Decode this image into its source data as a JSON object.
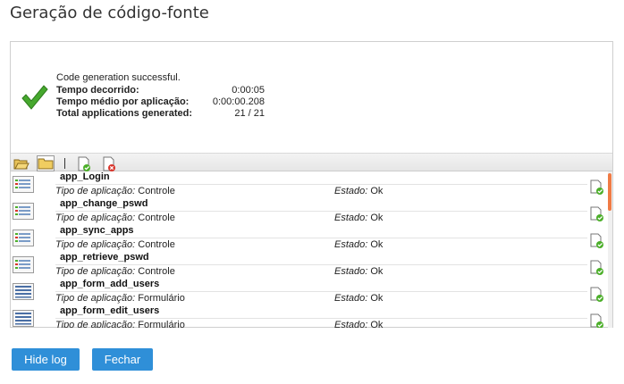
{
  "title": "Geração de código-fonte",
  "summary": {
    "message": "Code generation successful.",
    "rows": [
      {
        "label": "Tempo decorrido:",
        "value": "0:00:05"
      },
      {
        "label": "Tempo médio por aplicação:",
        "value": "0:00:00.208"
      },
      {
        "label": "Total applications generated:",
        "value": "21 / 21"
      }
    ]
  },
  "toolbar": {
    "icons": [
      "folder-open-icon",
      "folder-closed-icon",
      "success-filter-icon",
      "error-filter-icon"
    ]
  },
  "labels": {
    "type": "Tipo de aplicação:",
    "state": "Estado:"
  },
  "apps": [
    {
      "name": "app_Login",
      "type": "Controle",
      "state": "Ok",
      "icon": "control-app-icon"
    },
    {
      "name": "app_change_pswd",
      "type": "Controle",
      "state": "Ok",
      "icon": "control-app-icon"
    },
    {
      "name": "app_sync_apps",
      "type": "Controle",
      "state": "Ok",
      "icon": "control-app-icon"
    },
    {
      "name": "app_retrieve_pswd",
      "type": "Controle",
      "state": "Ok",
      "icon": "control-app-icon"
    },
    {
      "name": "app_form_add_users",
      "type": "Formulário",
      "state": "Ok",
      "icon": "form-app-icon"
    },
    {
      "name": "app_form_edit_users",
      "type": "Formulário",
      "state": "Ok",
      "icon": "form-app-icon"
    }
  ],
  "buttons": {
    "hide_log": "Hide log",
    "close": "Fechar"
  },
  "colors": {
    "button": "#2f8fd8",
    "success": "#4caf2a",
    "error": "#d9342b",
    "scroll_thumb": "#f07b45"
  }
}
